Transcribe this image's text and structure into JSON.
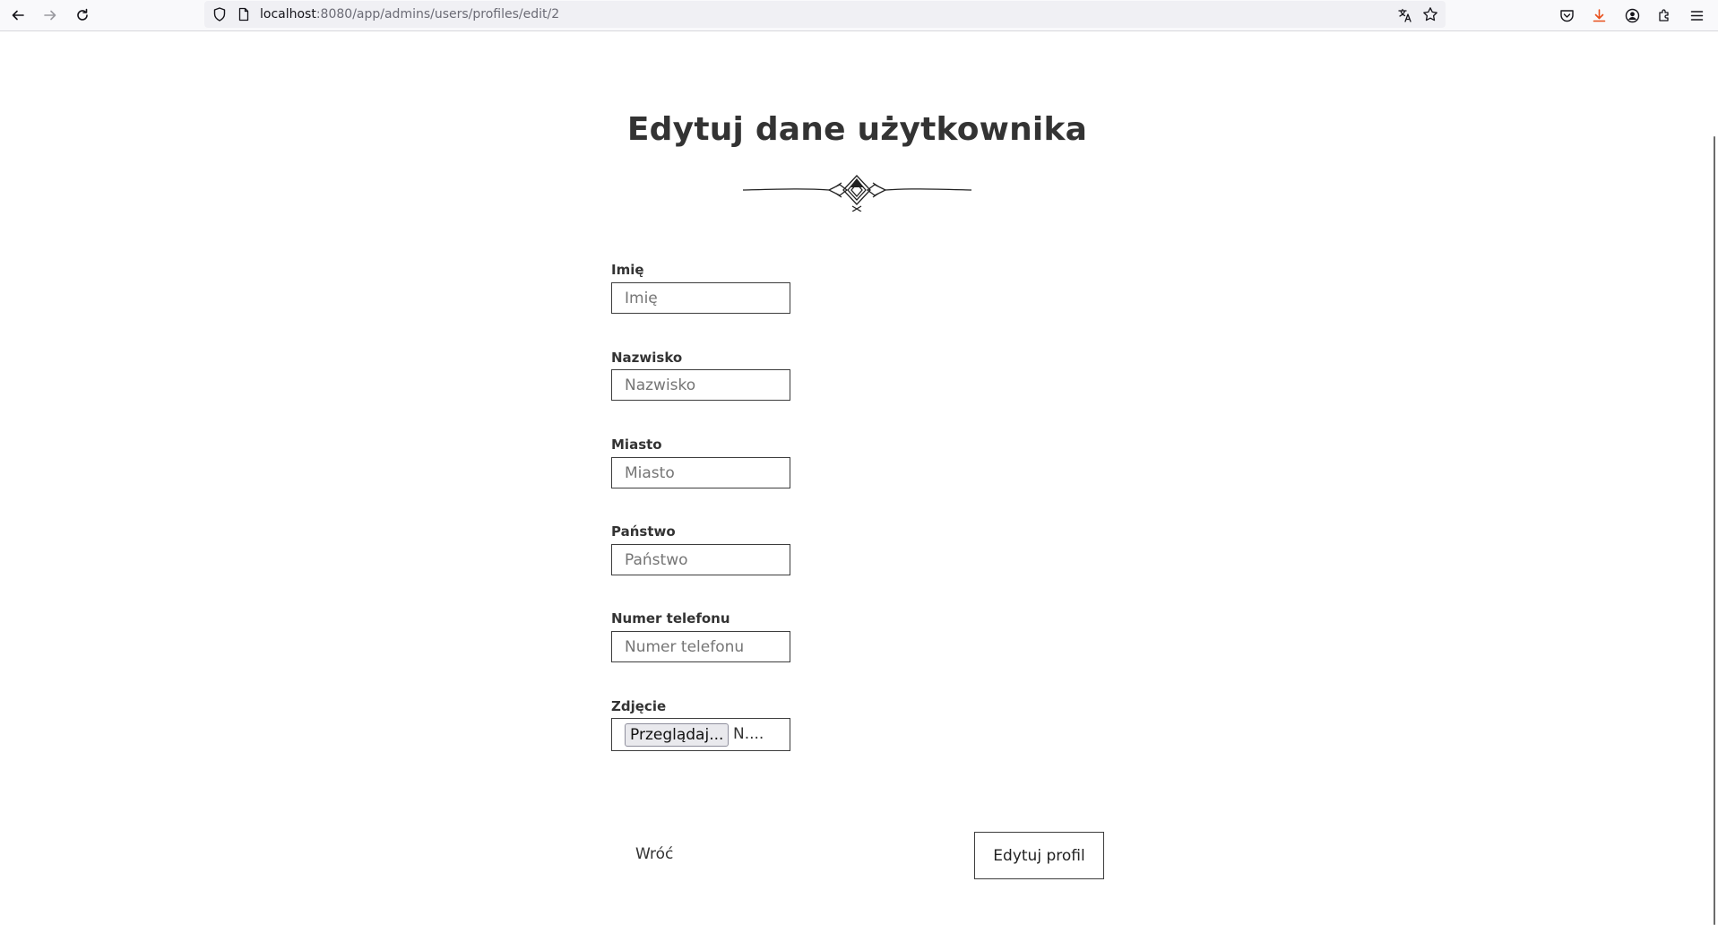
{
  "browser": {
    "url_host": "localhost",
    "url_rest": ":8080/app/admins/users/profiles/edit/2",
    "icons": [
      "back-arrow-icon",
      "forward-arrow-icon",
      "reload-icon",
      "shield-icon",
      "page-icon",
      "translate-icon",
      "bookmark-star-icon",
      "pocket-icon",
      "download-icon",
      "account-icon",
      "extensions-icon",
      "menu-icon"
    ],
    "download_color": "#e8501b"
  },
  "page": {
    "title": "Edytuj dane użytkownika",
    "fields": [
      {
        "label": "Imię",
        "placeholder": "Imię",
        "value": ""
      },
      {
        "label": "Nazwisko",
        "placeholder": "Nazwisko",
        "value": ""
      },
      {
        "label": "Miasto",
        "placeholder": "Miasto",
        "value": ""
      },
      {
        "label": "Państwo",
        "placeholder": "Państwo",
        "value": ""
      },
      {
        "label": "Numer telefonu",
        "placeholder": "Numer telefonu",
        "value": ""
      }
    ],
    "photo": {
      "label": "Zdjęcie",
      "button_label": "Przeglądaj...",
      "status": "N...."
    },
    "back_label": "Wróć",
    "submit_label": "Edytuj profil"
  }
}
